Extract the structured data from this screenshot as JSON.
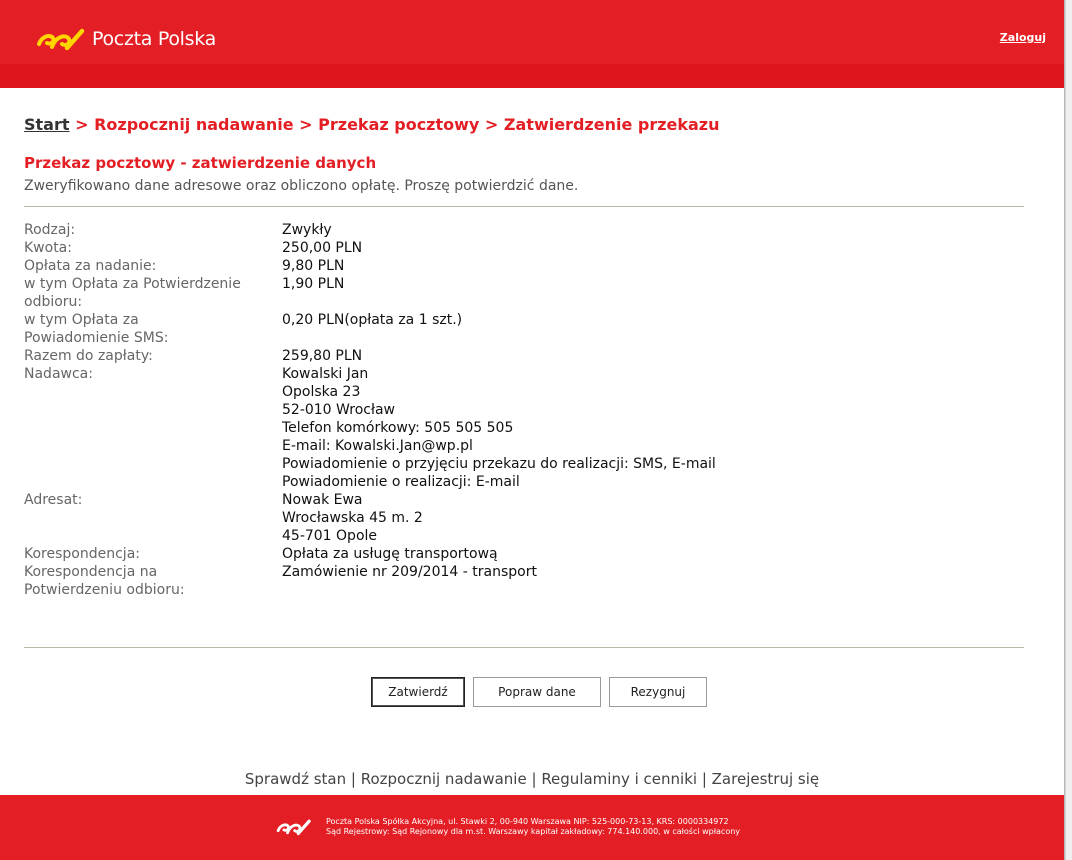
{
  "header": {
    "brand": "Poczta Polska",
    "logout_label": "Zaloguj",
    "colors": {
      "brand_red": "#e31e24",
      "logo_yellow": "#ffd500"
    }
  },
  "breadcrumb": {
    "start": "Start",
    "trail": " > Rozpocznij nadawanie > Przekaz pocztowy > Zatwierdzenie przekazu"
  },
  "page": {
    "title": "Przekaz pocztowy - zatwierdzenie danych",
    "subtitle": "Zweryfikowano dane adresowe oraz obliczono opłatę. Proszę potwierdzić dane."
  },
  "details": [
    {
      "label": [
        "Rodzaj:"
      ],
      "value": [
        "Zwykły"
      ]
    },
    {
      "label": [
        "Kwota:"
      ],
      "value": [
        "250,00 PLN"
      ]
    },
    {
      "label": [
        "Opłata za nadanie:"
      ],
      "value": [
        "9,80 PLN"
      ]
    },
    {
      "label": [
        "w tym Opłata za Potwierdzenie",
        "odbioru:"
      ],
      "value": [
        "1,90 PLN"
      ]
    },
    {
      "label": [
        "w tym Opłata za",
        "Powiadomienie SMS:"
      ],
      "value": [
        "0,20 PLN(opłata za 1 szt.)"
      ]
    },
    {
      "label": [
        "Razem do zapłaty:"
      ],
      "value": [
        "259,80 PLN"
      ]
    },
    {
      "label": [
        "Nadawca:"
      ],
      "value": [
        "Kowalski Jan",
        "Opolska 23",
        "52-010 Wrocław",
        "Telefon komórkowy: 505 505 505",
        "E-mail: Kowalski.Jan@wp.pl",
        "Powiadomienie o przyjęciu przekazu do realizacji: SMS, E-mail",
        "Powiadomienie o realizacji: E-mail"
      ]
    },
    {
      "label": [
        "Adresat:"
      ],
      "value": [
        "Nowak Ewa",
        "Wrocławska 45 m. 2",
        "45-701 Opole"
      ]
    },
    {
      "label": [
        "Korespondencja:"
      ],
      "value": [
        "Opłata za usługę transportową"
      ]
    },
    {
      "label": [
        "Korespondencja na",
        "Potwierdzeniu odbioru:"
      ],
      "value": [
        "Zamówienie nr 209/2014 - transport"
      ]
    }
  ],
  "buttons": {
    "confirm": "Zatwierdź",
    "edit": "Popraw dane",
    "cancel": "Rezygnuj"
  },
  "footer_links": [
    "Sprawdź stan",
    "Rozpocznij nadawanie",
    "Regulaminy i cenniki",
    "Zarejestruj się"
  ],
  "footer_separator": " | ",
  "footer": {
    "line1": "Poczta Polska Spółka Akcyjna, ul. Stawki 2, 00-940 Warszawa NIP: 525-000-73-13, KRS: 0000334972",
    "line2": "Sąd Rejestrowy: Sąd Rejonowy dla m.st. Warszawy kapitał zakładowy: 774.140.000, w całości wpłacony"
  }
}
